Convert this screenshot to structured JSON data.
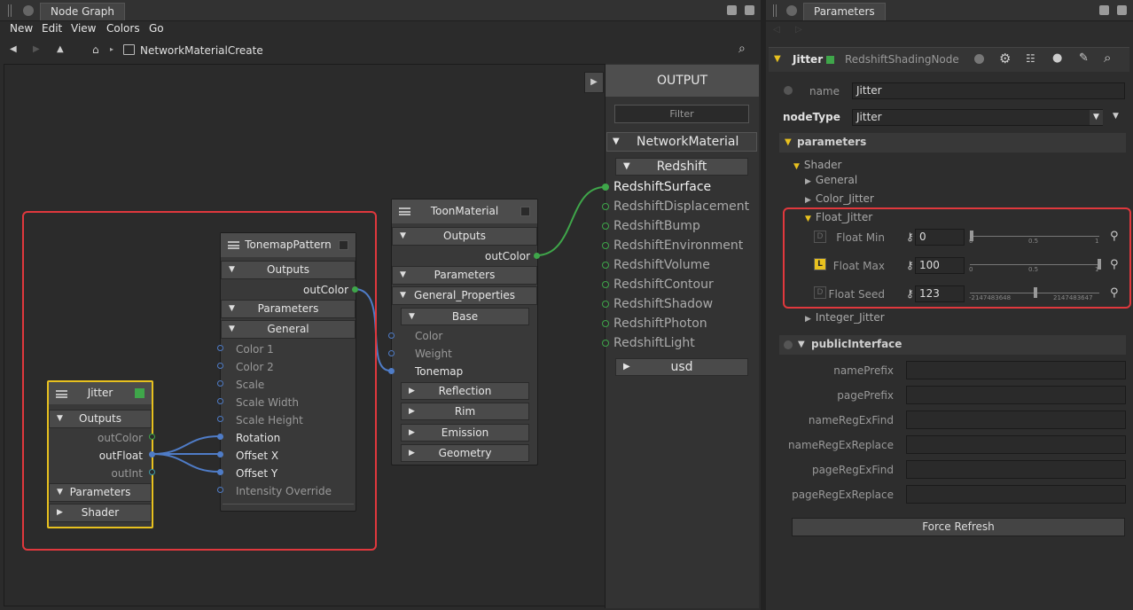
{
  "node_graph": {
    "tab_label": "Node Graph",
    "menu": [
      "New",
      "Edit",
      "View",
      "Colors",
      "Go"
    ],
    "breadcrumb": "NetworkMaterialCreate",
    "nodes": {
      "jitter": {
        "title": "Jitter",
        "outputs_label": "Outputs",
        "outputs": [
          "outColor",
          "outFloat",
          "outInt"
        ],
        "parameters_label": "Parameters",
        "shader_label": "Shader"
      },
      "tonemap": {
        "title": "TonemapPattern",
        "outputs_label": "Outputs",
        "out_port": "outColor",
        "parameters_label": "Parameters",
        "general_label": "General",
        "inputs": [
          "Color 1",
          "Color 2",
          "Scale",
          "Scale Width",
          "Scale Height",
          "Rotation",
          "Offset X",
          "Offset Y",
          "Intensity Override"
        ]
      },
      "toon": {
        "title": "ToonMaterial",
        "outputs_label": "Outputs",
        "out_port": "outColor",
        "parameters_label": "Parameters",
        "general_properties_label": "General_Properties",
        "base_label": "Base",
        "base_inputs": [
          "Color",
          "Weight",
          "Tonemap"
        ],
        "groups": [
          "Reflection",
          "Rim",
          "Emission",
          "Geometry"
        ]
      }
    },
    "output_panel": {
      "title": "OUTPUT",
      "filter_placeholder": "Filter",
      "network_material": "NetworkMaterial",
      "redshift_label": "Redshift",
      "ports": [
        "RedshiftSurface",
        "RedshiftDisplacement",
        "RedshiftBump",
        "RedshiftEnvironment",
        "RedshiftVolume",
        "RedshiftContour",
        "RedshiftShadow",
        "RedshiftPhoton",
        "RedshiftLight"
      ],
      "usd_label": "usd"
    }
  },
  "parameters": {
    "tab_label": "Parameters",
    "node_name": "Jitter",
    "node_type_label": "RedshiftShadingNode",
    "name_label": "name",
    "name_value": "Jitter",
    "nodetype_label": "nodeType",
    "nodetype_value": "Jitter",
    "parameters_header": "parameters",
    "tree": {
      "shader": "Shader",
      "general": "General",
      "color_jitter": "Color_Jitter",
      "float_jitter": "Float_Jitter",
      "integer_jitter": "Integer_Jitter"
    },
    "float_rows": [
      {
        "label": "Float Min",
        "value": "0",
        "ticks": [
          "0",
          "0.5",
          "1"
        ],
        "slider": 0.0,
        "badge": "D"
      },
      {
        "label": "Float Max",
        "value": "100",
        "ticks": [
          "0",
          "0.5",
          "1"
        ],
        "slider": 1.0,
        "badge": "L"
      },
      {
        "label": "Float Seed",
        "value": "123",
        "ticks": [
          "-2147483648",
          "2147483647"
        ],
        "slider": 0.5,
        "badge": "D"
      }
    ],
    "public_interface_header": "publicInterface",
    "public_fields": [
      "namePrefix",
      "pagePrefix",
      "nameRegExFind",
      "nameRegExReplace",
      "pageRegExFind",
      "pageRegExReplace"
    ],
    "force_refresh_label": "Force Refresh"
  },
  "colors": {
    "highlight_red": "#e0383d",
    "node_selected": "#e8c11f",
    "wire_blue": "#4f7cc7",
    "wire_green": "#3fa64a"
  }
}
